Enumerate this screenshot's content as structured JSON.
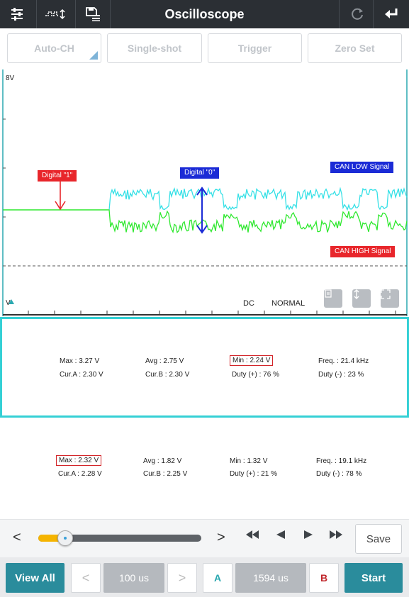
{
  "header": {
    "title": "Oscilloscope",
    "icons": [
      "settings-sliders-icon",
      "signal-measure-icon",
      "save-file-icon",
      "refresh-icon",
      "back-icon"
    ]
  },
  "modes": {
    "auto_ch": "Auto-CH",
    "single_shot": "Single-shot",
    "trigger": "Trigger",
    "zero_set": "Zero Set"
  },
  "scope": {
    "top_voltage": "8V",
    "bottom_voltage": "V",
    "coupling": "DC",
    "mode": "NORMAL",
    "labels": {
      "digital_1": "Digital \"1\"",
      "digital_0": "Digital \"0\"",
      "can_low": "CAN LOW Signal",
      "can_high": "CAN HIGH Signal"
    },
    "colors": {
      "channel_a": "#35e0e6",
      "channel_b": "#2ee82e",
      "red": "#e8262b",
      "blue": "#1b2bd6"
    }
  },
  "measurements": {
    "channel1": {
      "max": "Max : 3.27 V",
      "cur_a": "Cur.A : 2.30 V",
      "avg": "Avg : 2.75 V",
      "cur_b": "Cur.B : 2.30 V",
      "min": "Min : 2.24 V",
      "duty_pos": "Duty (+) : 76 %",
      "freq": "Freq. : 21.4 kHz",
      "duty_neg": "Duty (-) : 23 %"
    },
    "channel2": {
      "max": "Max : 2.32 V",
      "cur_a": "Cur.A : 2.28 V",
      "avg": "Avg : 1.82 V",
      "cur_b": "Cur.B : 2.25 V",
      "min": "Min : 1.32 V",
      "duty_pos": "Duty (+) : 21 %",
      "freq": "Freq. : 19.1 kHz",
      "duty_neg": "Duty (-) : 78 %"
    }
  },
  "playback": {
    "prev": "<",
    "next": ">",
    "slider_position_fraction": 0.15,
    "save": "Save"
  },
  "bottom": {
    "view_all": "View All",
    "time_prev": "<",
    "timebase": "100 us",
    "time_next": ">",
    "cursor_a": "A",
    "cursor_delta": "1594 us",
    "cursor_b": "B",
    "start": "Start"
  }
}
